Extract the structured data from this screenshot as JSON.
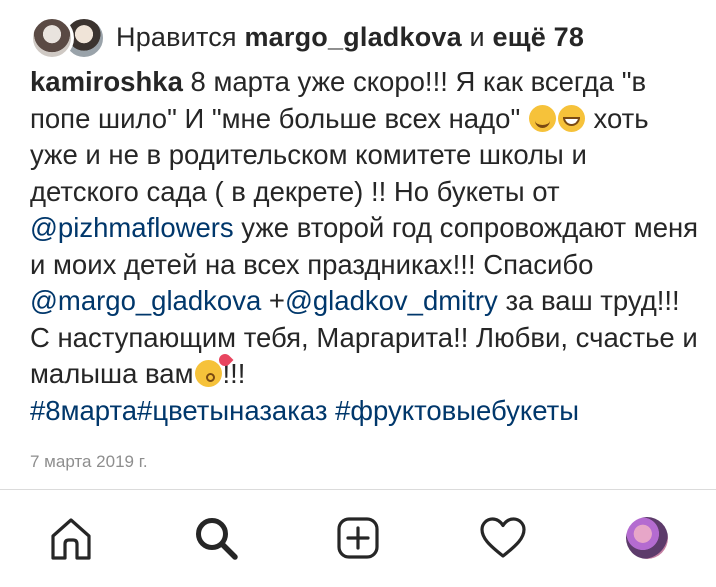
{
  "likes": {
    "prefix": "Нравится ",
    "user": "margo_gladkova",
    "middle": " и ",
    "others": "ещё 78"
  },
  "caption": {
    "username": "kamiroshka",
    "text_1": " 8 марта уже скоро!!! Я как всегда \"в попе шило\" И \"мне больше всех надо\" ",
    "text_2": " хоть уже и не в родительском комитете школы и детского сада ( в декрете) !! Но букеты от ",
    "mention_1": "@pizhmaflowers",
    "text_3": "  уже второй год сопровождают меня и  моих детей на всех праздниках!!! Спасибо ",
    "mention_2": "@margo_gladkova",
    "text_4": " +",
    "mention_3": "@gladkov_dmitry",
    "text_5": "  за ваш труд!!! С наступающим тебя,  Маргарита!! Любви, счастье и малыша вам",
    "text_6": "!!!",
    "tags": "#8марта#цветыназаказ #фруктовыебукеты"
  },
  "date": "7 марта 2019 г.",
  "icons": {
    "emoji_1": "smiling-face-emoji",
    "emoji_2": "grinning-face-emoji",
    "emoji_3": "kissing-face-emoji",
    "nav": [
      "home-icon",
      "search-icon",
      "add-post-icon",
      "heart-icon",
      "profile-avatar"
    ]
  },
  "colors": {
    "text": "#262626",
    "link": "#00376b",
    "muted": "#8e8e8e",
    "divider": "#dbdbdb"
  }
}
